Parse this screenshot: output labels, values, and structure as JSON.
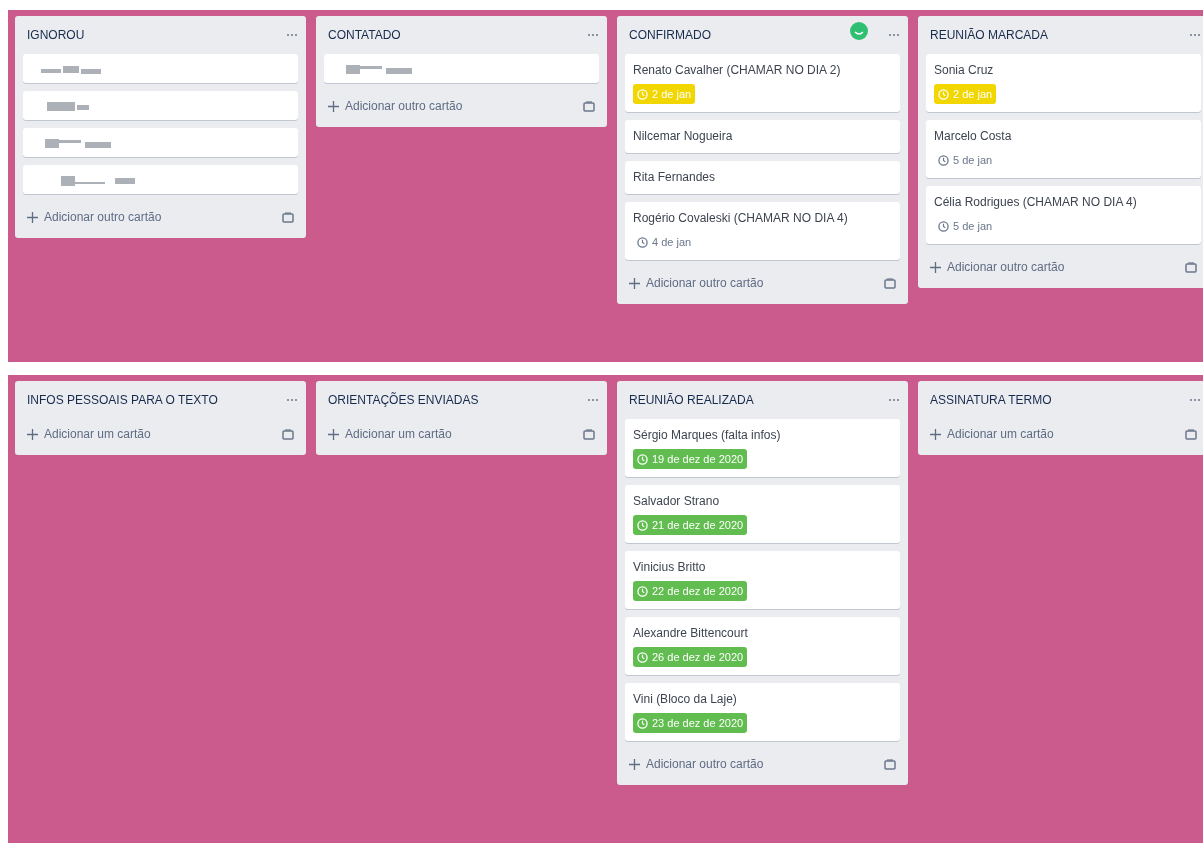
{
  "rows": [
    {
      "lists": [
        {
          "title": "IGNOROU",
          "avatar": false,
          "cards": [
            {
              "kind": "redacted"
            },
            {
              "kind": "redacted"
            },
            {
              "kind": "redacted"
            },
            {
              "kind": "redacted"
            }
          ],
          "add_label": "Adicionar outro cartão"
        },
        {
          "title": "CONTATADO",
          "avatar": false,
          "cards": [
            {
              "kind": "redacted"
            }
          ],
          "add_label": "Adicionar outro cartão"
        },
        {
          "title": "CONFIRMADO",
          "avatar": true,
          "cards": [
            {
              "kind": "card",
              "name": "Renato Cavalher (CHAMAR NO DIA 2)",
              "due": {
                "text": "2 de jan",
                "kind": "soon"
              }
            },
            {
              "kind": "card",
              "name": "Nilcemar Nogueira"
            },
            {
              "kind": "card",
              "name": "Rita Fernandes"
            },
            {
              "kind": "card",
              "name": "Rogério Covaleski (CHAMAR NO DIA 4)",
              "due": {
                "text": "4 de jan",
                "kind": "later"
              }
            }
          ],
          "add_label": "Adicionar outro cartão"
        },
        {
          "title": "REUNIÃO MARCADA",
          "avatar": false,
          "cards": [
            {
              "kind": "card",
              "name": "Sonia Cruz",
              "due": {
                "text": "2 de jan",
                "kind": "soon"
              }
            },
            {
              "kind": "card",
              "name": "Marcelo Costa",
              "due": {
                "text": "5 de jan",
                "kind": "later"
              }
            },
            {
              "kind": "card",
              "name": "Célia Rodrigues (CHAMAR NO DIA 4)",
              "due": {
                "text": "5 de jan",
                "kind": "later"
              }
            }
          ],
          "add_label": "Adicionar outro cartão"
        }
      ]
    },
    {
      "lists": [
        {
          "title": "INFOS PESSOAIS PARA O TEXTO",
          "avatar": false,
          "add_label": "Adicionar um cartão"
        },
        {
          "title": "ORIENTAÇÕES ENVIADAS",
          "avatar": false,
          "add_label": "Adicionar um cartão"
        },
        {
          "title": "REUNIÃO REALIZADA",
          "avatar": false,
          "cards": [
            {
              "kind": "card",
              "name": "Sérgio Marques (falta infos)",
              "due": {
                "text": "19 de dez de 2020",
                "kind": "done"
              }
            },
            {
              "kind": "card",
              "name": "Salvador Strano",
              "due": {
                "text": "21 de dez de 2020",
                "kind": "done"
              }
            },
            {
              "kind": "card",
              "name": "Vinicius Britto",
              "due": {
                "text": "22 de dez de 2020",
                "kind": "done"
              }
            },
            {
              "kind": "card",
              "name": "Alexandre Bittencourt",
              "due": {
                "text": "26 de dez de 2020",
                "kind": "done"
              }
            },
            {
              "kind": "card",
              "name": "Vini (Bloco da Laje)",
              "due": {
                "text": "23 de dez de 2020",
                "kind": "done"
              }
            }
          ],
          "add_label": "Adicionar outro cartão"
        },
        {
          "title": "ASSINATURA TERMO",
          "avatar": false,
          "add_label": "Adicionar um cartão"
        }
      ]
    }
  ]
}
